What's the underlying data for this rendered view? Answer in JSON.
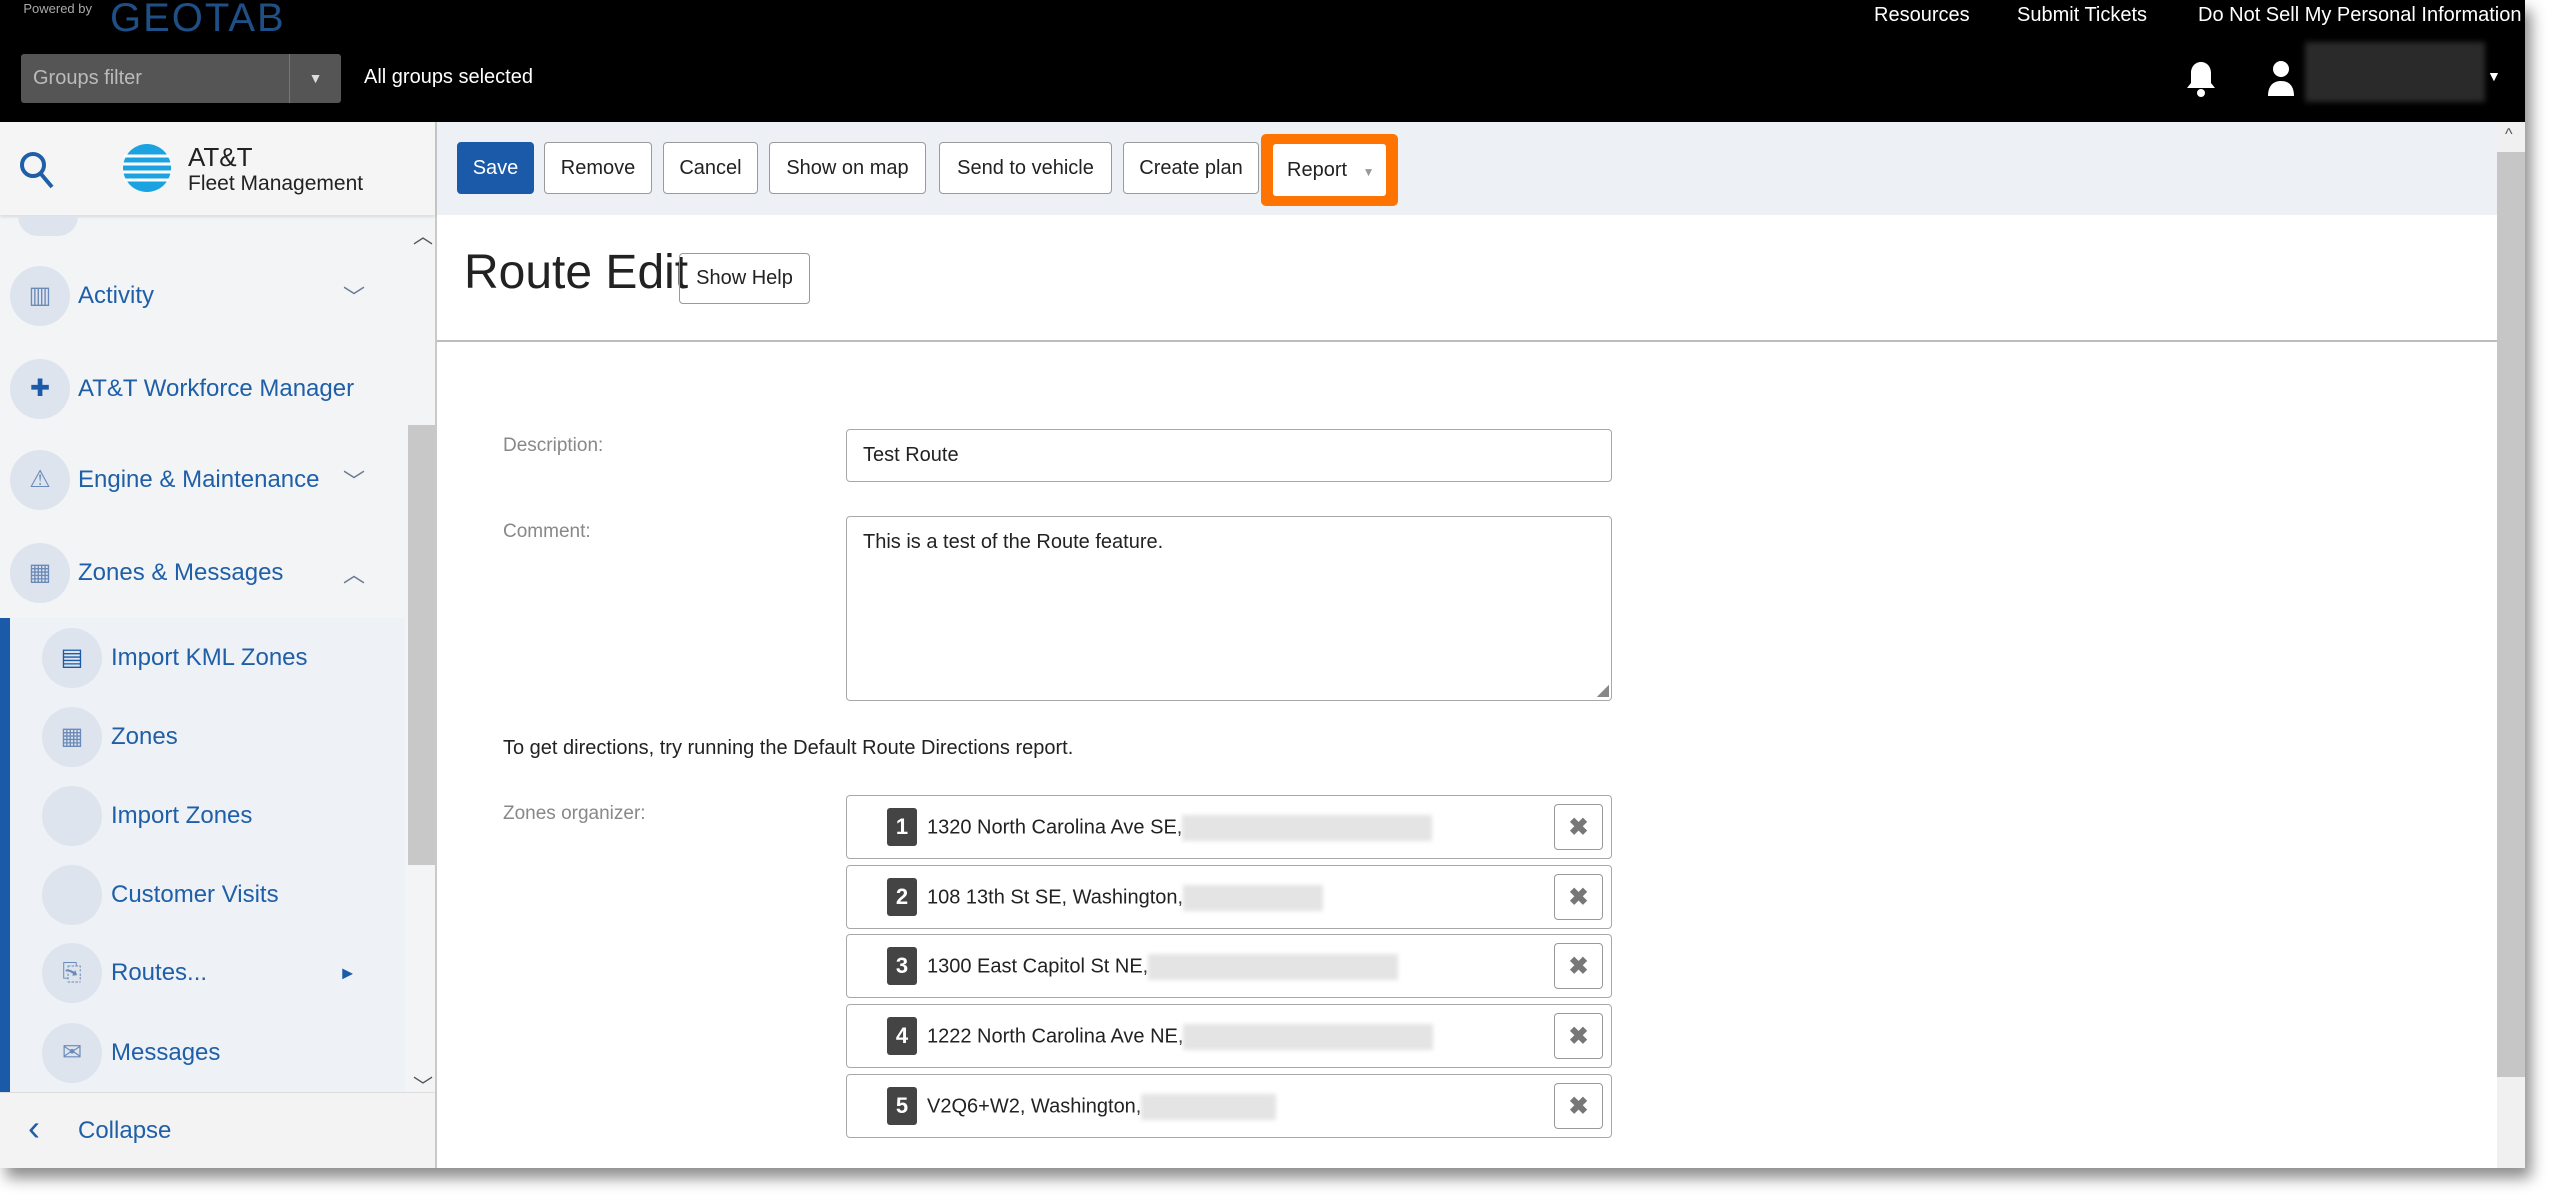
{
  "header": {
    "logo_powered": "Powered by",
    "logo_brand": "GEOTAB",
    "links": [
      "Resources",
      "Submit Tickets",
      "Do Not Sell My Personal Information"
    ],
    "groups_filter_placeholder": "Groups filter",
    "groups_status": "All groups selected",
    "icons": {
      "notifications": "bell-icon",
      "user": "user-icon"
    }
  },
  "sidebar": {
    "brand_title": "AT&T",
    "brand_subtitle": "Fleet Management",
    "items": [
      {
        "label": "Activity",
        "icon": "activity-chart-icon",
        "chevron": "down"
      },
      {
        "label": "AT&T Workforce Manager",
        "icon": "puzzle-icon"
      },
      {
        "label": "Engine & Maintenance",
        "icon": "engine-icon",
        "chevron": "down"
      },
      {
        "label": "Zones & Messages",
        "icon": "zones-icon",
        "chevron": "up"
      }
    ],
    "subitems": [
      {
        "label": "Import KML Zones",
        "icon": "kml-file-icon"
      },
      {
        "label": "Zones",
        "icon": "zones-icon"
      },
      {
        "label": "Import Zones",
        "icon": ""
      },
      {
        "label": "Customer Visits",
        "icon": ""
      },
      {
        "label": "Routes...",
        "icon": "routes-icon",
        "has_submenu": true
      },
      {
        "label": "Messages",
        "icon": "envelope-icon"
      }
    ],
    "collapse_label": "Collapse"
  },
  "toolbar": {
    "save": "Save",
    "remove": "Remove",
    "cancel": "Cancel",
    "show_on_map": "Show on map",
    "send_to_vehicle": "Send to vehicle",
    "create_plan": "Create plan",
    "report": "Report",
    "highlight_color": "#ff7300",
    "primary_color": "#1a5aa8"
  },
  "page": {
    "title": "Route Edit",
    "show_help": "Show Help",
    "description_label": "Description:",
    "description_value": "Test Route",
    "comment_label": "Comment:",
    "comment_value": "This is a test of the Route feature.",
    "hint": "To get directions, try running the Default Route Directions report.",
    "zones_label": "Zones organizer:",
    "zones": [
      {
        "number": "1",
        "address": "1320 North Carolina Ave SE,"
      },
      {
        "number": "2",
        "address": "108 13th St SE, Washington,"
      },
      {
        "number": "3",
        "address": "1300 East Capitol St NE,"
      },
      {
        "number": "4",
        "address": "1222 North Carolina Ave NE,"
      },
      {
        "number": "5",
        "address": "V2Q6+W2, Washington,"
      }
    ]
  }
}
